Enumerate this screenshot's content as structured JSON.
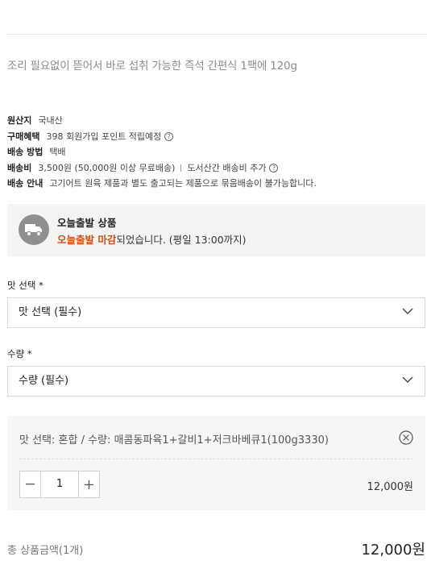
{
  "description": "조리 필요없이 뜯어서 바로 섭취 가능한 즉석 간편식 1팩에 120g",
  "info": {
    "origin": {
      "label": "원산지",
      "value": "국내산"
    },
    "benefit": {
      "label": "구매혜택",
      "value": "398 회원가입 포인트 적립예정"
    },
    "method": {
      "label": "배송 방법",
      "value": "택배"
    },
    "fee": {
      "label": "배송비",
      "value": "3,500원 (50,000원 이상 무료배송)",
      "extra": "도서산간 배송비 추가"
    },
    "notice": {
      "label": "배송 안내",
      "value": "고기어트 원육 제품과 별도 출고되는 제품으로 묶음배송이 불가능합니다."
    }
  },
  "today": {
    "title": "오늘출발 상품",
    "highlight": "오늘출발 마감",
    "rest": "되었습니다. (평일 13:00까지)"
  },
  "flavor": {
    "label": "맛 선택 *",
    "placeholder": "맛 선택 (필수)"
  },
  "quantity": {
    "label": "수량 *",
    "placeholder": "수량 (필수)"
  },
  "selected_option": {
    "text": "맛 선택: 혼합 / 수량: 매콤동파육1+갈비1+저크바베큐1(100g3330)",
    "qty": "1",
    "price": "12,000원"
  },
  "total": {
    "label": "총 상품금액(1개)",
    "price": "12,000원"
  },
  "icons": [
    "truck-icon",
    "help-icon",
    "chevron-down-icon",
    "close-circle-icon",
    "minus-icon",
    "plus-icon"
  ],
  "colors": {
    "accent": "#d04b14",
    "panel": "#f4f4f4",
    "icon_gray": "#8f8f8f"
  }
}
